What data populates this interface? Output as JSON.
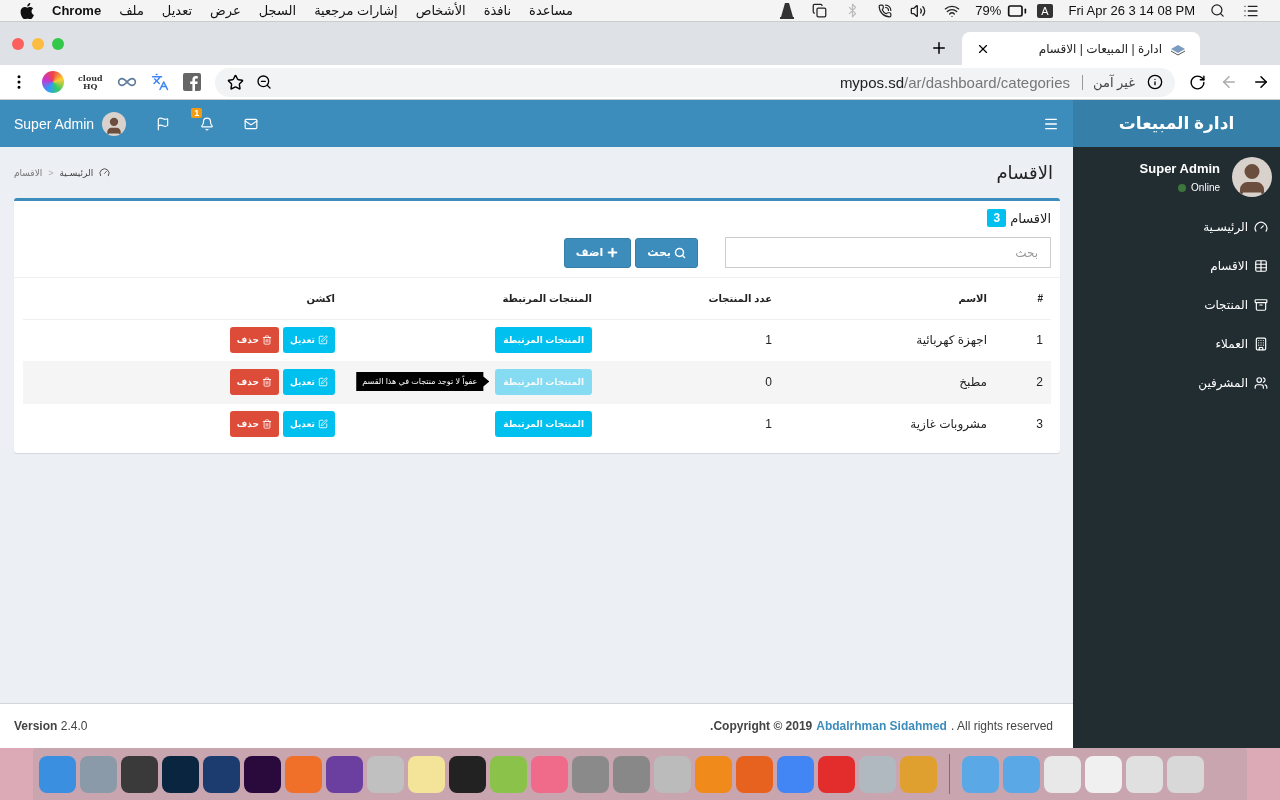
{
  "menubar": {
    "app": "Chrome",
    "menus": [
      "مساعدة",
      "نافذة",
      "الأشخاص",
      "إشارات مرجعية",
      "السجل",
      "عرض",
      "تعديل",
      "ملف"
    ],
    "battery": "79%",
    "input_source": "A",
    "clock": "Fri Apr 26  3 14 08 PM"
  },
  "browser": {
    "tab": {
      "title": "ادارة | المبيعات | الاقسام"
    },
    "extension_label": [
      "cloud",
      "HQ"
    ],
    "address": {
      "domain": "mypos.sd",
      "path": "/ar/dashboard/categories",
      "security": "غير آمن"
    }
  },
  "header": {
    "brand": "ادارة المبيعات",
    "user": "Super Admin",
    "notification_count": "1"
  },
  "sidebar": {
    "user": {
      "name": "Super Admin",
      "status": "Online"
    },
    "items": [
      {
        "label": "الرئيسـية",
        "kind": "dashboard"
      },
      {
        "label": "الاقسام",
        "kind": "categories"
      },
      {
        "label": "المنتجات",
        "kind": "products"
      },
      {
        "label": "العملاء",
        "kind": "clients"
      },
      {
        "label": "المشرفين",
        "kind": "users"
      }
    ]
  },
  "page_title": "الاقسام",
  "breadcrumb": [
    "الرئيسـية",
    "الاقسام"
  ],
  "breadcrumb_separator": "<",
  "box": {
    "title": "الاقسام",
    "count": "3",
    "search": {
      "placeholder": "بحث"
    },
    "search_button": "بحث",
    "add_button": "اضف"
  },
  "table": {
    "columns": [
      "#",
      "الاسم",
      "عدد المنتجات",
      "المنتجات المرتبطة",
      "اكشن"
    ],
    "rows": [
      {
        "index": "1",
        "name": "اجهزة كهربائية",
        "count": "1",
        "products_button": "المنتجات المرتبطة",
        "products_disabled": false,
        "edit": "تعديل",
        "delete": "حذف"
      },
      {
        "index": "2",
        "name": "مطبخ",
        "count": "0",
        "products_button": "المنتجات المرتبطة",
        "products_disabled": true,
        "tooltip": "عفواً لا توجد منتجات في هذا القسم",
        "edit": "تعديل",
        "delete": "حذف"
      },
      {
        "index": "3",
        "name": "مشروبات غازية",
        "count": "1",
        "products_button": "المنتجات المرتبطة",
        "products_disabled": false,
        "edit": "تعديل",
        "delete": "حذف"
      }
    ]
  },
  "footer": {
    "version_label": "Version",
    "version": "2.4.0",
    "copyright": ".Copyright © 2019",
    "author": "Abdalrhman Sidahmed",
    "rights": ". All rights reserved"
  }
}
